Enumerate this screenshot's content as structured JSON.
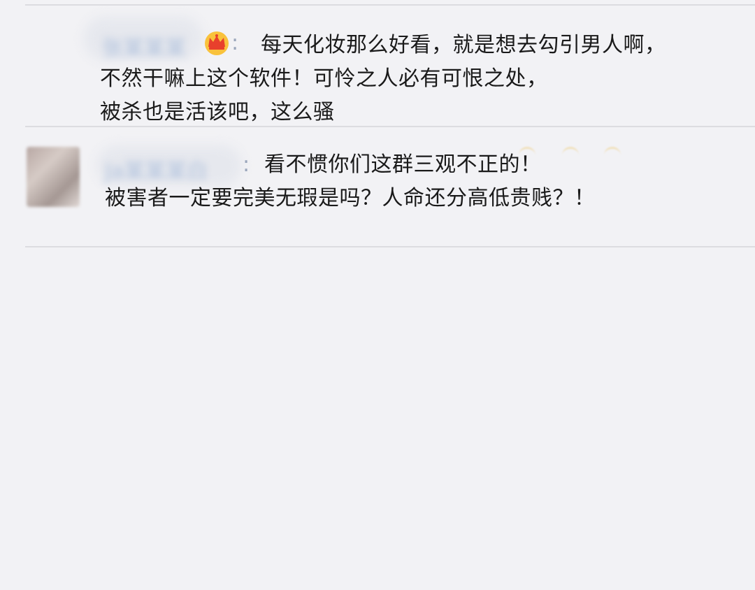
{
  "comments": [
    {
      "username": "张某某某",
      "lines": [
        "每天化妆那么好看，就是想去勾引男人啊，",
        "不然干嘛上这个软件！可怜之人必有可恨之处，",
        "被杀也是活该吧，这么骚"
      ]
    },
    {
      "username": "Ja某某某白",
      "lines": [
        "看不惯你们这群三观不正的！",
        "被害者一定要完美无瑕是吗？人命还分高低贵贱？！"
      ]
    }
  ],
  "icons": {
    "comment1_badge": "crown-icon",
    "comment2_avatar": "avatar",
    "comment2_reactions": "emoji-icon"
  },
  "colors": {
    "background": "#f2f2f5",
    "divider": "#dcdce0",
    "username_blur": "#aec0dc",
    "text": "#1a1a1a"
  }
}
